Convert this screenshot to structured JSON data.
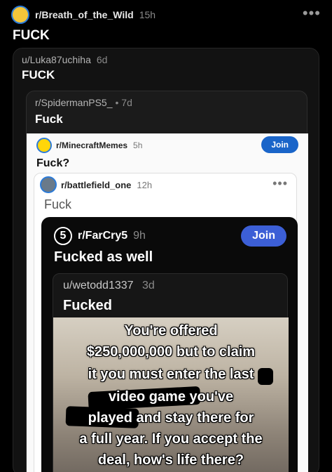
{
  "post0": {
    "subreddit": "r/Breath_of_the_Wild",
    "time": "15h",
    "title": "FUCK",
    "more": "•••"
  },
  "post1": {
    "author": "u/Luka87uchiha",
    "time": "6d",
    "title": "FUCK"
  },
  "post2": {
    "subreddit": "r/SpidermanPS5_",
    "time": "• 7d",
    "title": "Fuck"
  },
  "post3": {
    "subreddit": "r/MinecraftMemes",
    "time": "5h",
    "title": "Fuck?",
    "join": "Join"
  },
  "post4": {
    "subreddit": "r/battlefield_one",
    "time": "12h",
    "title": "Fuck",
    "more": "•••"
  },
  "post5": {
    "subreddit": "r/FarCry5",
    "time": "9h",
    "title": "Fucked as well",
    "join": "Join",
    "avatar_text": "5"
  },
  "post6": {
    "author": "u/wetodd1337",
    "time": "3d",
    "title": "Fucked"
  },
  "meme": {
    "lines": [
      "You're offered",
      "$250,000,000 but to claim",
      "it you must enter the last",
      "video game       you've",
      "played      and stay there for",
      "a full year. If you accept the",
      "deal, how's life there?"
    ]
  }
}
